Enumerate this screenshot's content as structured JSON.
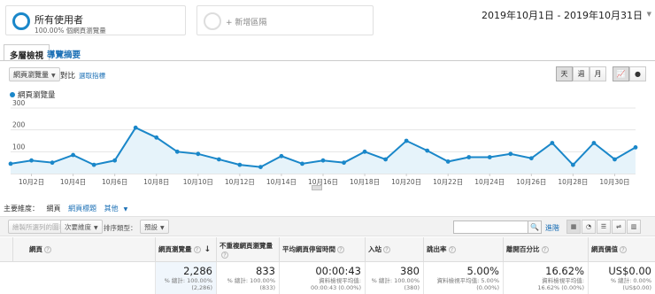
{
  "segments": {
    "primary": {
      "title": "所有使用者",
      "subtitle": "100.00% 個網頁瀏覽量"
    },
    "add": {
      "label": "+ 新增區隔"
    }
  },
  "date_range": "2019年10月1日 - 2019年10月31日",
  "tabs": [
    {
      "label": "多層檢視",
      "active": true
    },
    {
      "label": "導覽摘要",
      "active": false
    }
  ],
  "metric_select": {
    "value": "網頁瀏覽量",
    "compare": "對比",
    "choose": "選取指標"
  },
  "period_buttons": [
    "天",
    "週",
    "月"
  ],
  "legend_label": "網頁瀏覽量",
  "colors": {
    "line": "#1a87c9",
    "fill": "#e6f3fa",
    "link": "#1a6fb5"
  },
  "chart_data": {
    "type": "area",
    "x": [
      "10月1日",
      "10月2日",
      "10月3日",
      "10月4日",
      "10月5日",
      "10月6日",
      "10月7日",
      "10月8日",
      "10月9日",
      "10月10日",
      "10月11日",
      "10月12日",
      "10月13日",
      "10月14日",
      "10月15日",
      "10月16日",
      "10月17日",
      "10月18日",
      "10月19日",
      "10月20日",
      "10月21日",
      "10月22日",
      "10月23日",
      "10月24日",
      "10月25日",
      "10月26日",
      "10月27日",
      "10月28日",
      "10月29日",
      "10月30日",
      "10月31日"
    ],
    "values": [
      45,
      60,
      50,
      85,
      40,
      60,
      210,
      165,
      100,
      90,
      65,
      40,
      30,
      80,
      45,
      60,
      50,
      100,
      65,
      150,
      105,
      55,
      75,
      75,
      90,
      70,
      140,
      40,
      140,
      65,
      120
    ],
    "ylim": [
      0,
      300
    ],
    "yticks": [
      "300",
      "200",
      "100"
    ],
    "xtick_labels": [
      "10月2日",
      "10月4日",
      "10月6日",
      "10月8日",
      "10月10日",
      "10月12日",
      "10月14日",
      "10月16日",
      "10月18日",
      "10月20日",
      "10月22日",
      "10月24日",
      "10月26日",
      "10月28日",
      "10月30日"
    ],
    "grid": true
  },
  "dims": {
    "label": "主要維度：",
    "items": [
      "網頁",
      "網頁標題",
      "其他"
    ]
  },
  "toolbar": {
    "plot_rows": "繪製所選列的圖表",
    "secondary_dim": "次要維度",
    "sort_type": "排序類型：",
    "sort_value": "預設",
    "search_placeholder": "",
    "advanced": "進階"
  },
  "table": {
    "columns": [
      {
        "label": "網頁"
      },
      {
        "label": "網頁瀏覽量"
      },
      {
        "label": "不重複網頁瀏覽量"
      },
      {
        "label": "平均網頁停留時間"
      },
      {
        "label": "入站"
      },
      {
        "label": "跳出率"
      },
      {
        "label": "離開百分比"
      },
      {
        "label": "網頁價值"
      }
    ],
    "totals": [
      {
        "value": "2,286",
        "sub1": "% 總計: 100.00%",
        "sub2": "(2,286)"
      },
      {
        "value": "833",
        "sub1": "% 總計: 100.00%",
        "sub2": "(833)"
      },
      {
        "value": "00:00:43",
        "sub1": "資料檢視平均值:",
        "sub2": "00:00:43 (0.00%)"
      },
      {
        "value": "380",
        "sub1": "% 總計: 100.00%",
        "sub2": "(380)"
      },
      {
        "value": "5.00%",
        "sub1": "資料檢視平均值: 5.00%",
        "sub2": "(0.00%)"
      },
      {
        "value": "16.62%",
        "sub1": "資料檢視平均值:",
        "sub2": "16.62% (0.00%)"
      },
      {
        "value": "US$0.00",
        "sub1": "% 總計: 0.00%",
        "sub2": "(US$0.00)"
      }
    ]
  }
}
